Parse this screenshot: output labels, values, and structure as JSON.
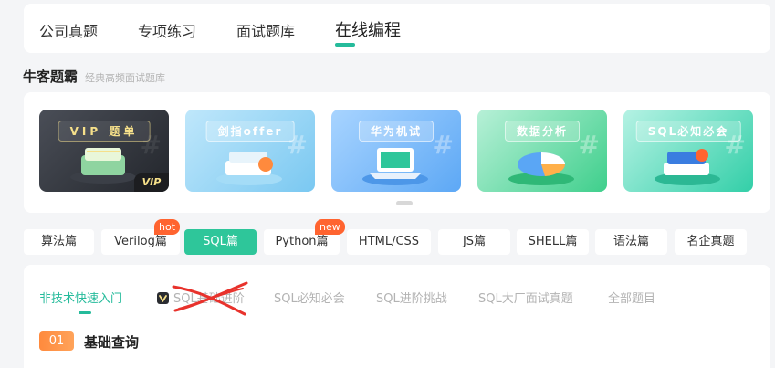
{
  "top_tabs": [
    {
      "label": "公司真题"
    },
    {
      "label": "专项练习"
    },
    {
      "label": "面试题库"
    },
    {
      "label": "在线编程",
      "active": true
    }
  ],
  "section": {
    "title": "牛客题霸",
    "subtitle": "经典高频面试题库"
  },
  "banners": [
    {
      "title": "VIP 题单",
      "badge": "VIP"
    },
    {
      "title": "剑指offer"
    },
    {
      "title": "华为机试"
    },
    {
      "title": "数据分析"
    },
    {
      "title": "SQL必知必会"
    }
  ],
  "categories": [
    {
      "label": "算法篇"
    },
    {
      "label": "Verilog篇",
      "badge": "hot"
    },
    {
      "label": "SQL篇",
      "active": true
    },
    {
      "label": "Python篇",
      "badge": "new"
    },
    {
      "label": "HTML/CSS"
    },
    {
      "label": "JS篇"
    },
    {
      "label": "SHELL篇"
    },
    {
      "label": "语法篇"
    },
    {
      "label": "名企真题"
    }
  ],
  "sub_tabs": [
    {
      "label": "非技术快速入门",
      "active": true
    },
    {
      "label": "SQL基础进阶",
      "vip": true,
      "crossed_out": true
    },
    {
      "label": "SQL必知必会"
    },
    {
      "label": "SQL进阶挑战"
    },
    {
      "label": "SQL大厂面试真题"
    },
    {
      "label": "全部题目"
    }
  ],
  "step": {
    "number": "01",
    "title": "基础查询"
  },
  "colors": {
    "accent": "#25bb9b",
    "badge_orange": "#ff6430",
    "annotation_red": "#e8322c"
  }
}
